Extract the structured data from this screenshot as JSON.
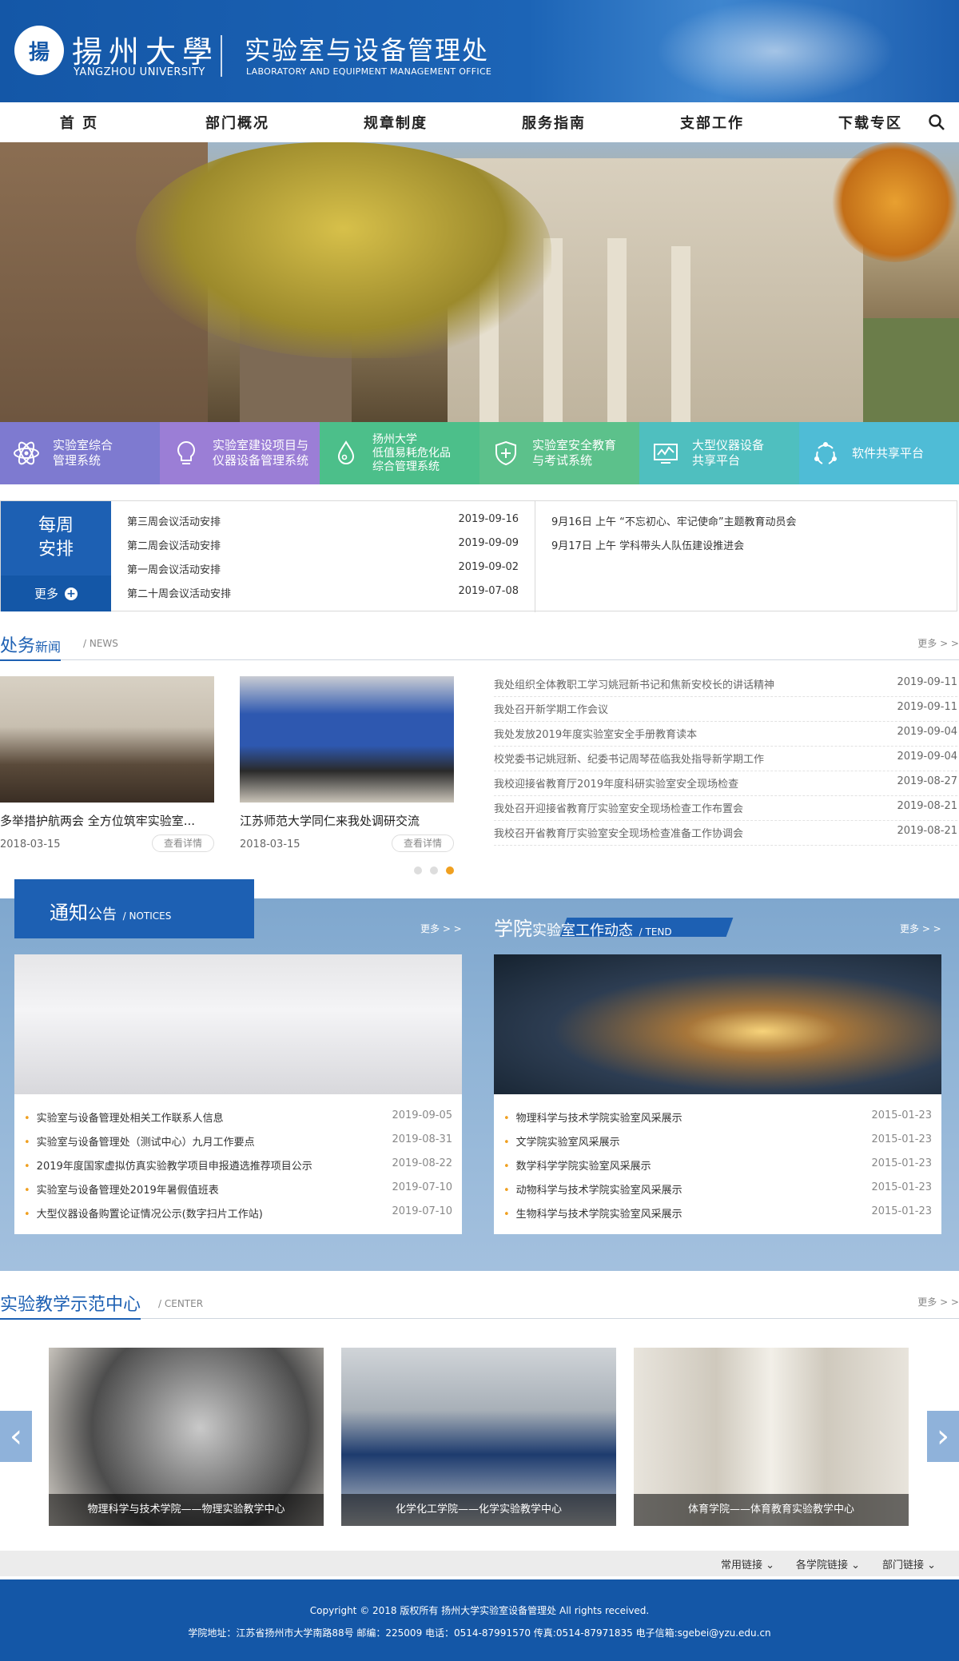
{
  "header": {
    "logo_glyph": "揚",
    "university_cn": "揚州大學",
    "university_en": "YANGZHOU UNIVERSITY",
    "office_cn": "实验室与设备管理处",
    "office_en": "LABORATORY AND EQUIPMENT MANAGEMENT OFFICE"
  },
  "nav": {
    "items": [
      "首 页",
      "部门概况",
      "规章制度",
      "服务指南",
      "支部工作",
      "下载专区"
    ],
    "search_icon": "search-icon"
  },
  "quick_links": [
    {
      "label": "实验室综合\n管理系统",
      "icon": "atom-icon",
      "color": "#7e7ad0"
    },
    {
      "label": "实验室建设项目与\n仪器设备管理系统",
      "icon": "lightbulb-icon",
      "color": "#9b7ed6"
    },
    {
      "label": "扬州大学\n低值易耗危化品\n综合管理系统",
      "icon": "flask-drop-icon",
      "color": "#4cbf8a"
    },
    {
      "label": "实验室安全教育\n与考试系统",
      "icon": "shield-plus-icon",
      "color": "#5cc18b"
    },
    {
      "label": "大型仪器设备\n共享平台",
      "icon": "monitor-chart-icon",
      "color": "#4fbfbf"
    },
    {
      "label": "软件共享平台",
      "icon": "share-circle-icon",
      "color": "#4fbcd6"
    }
  ],
  "weekly": {
    "title_line1": "每周",
    "title_line2": "安排",
    "more": "更多",
    "rows": [
      {
        "title": "第三周会议活动安排",
        "date": "2019-09-16"
      },
      {
        "title": "第二周会议活动安排",
        "date": "2019-09-09"
      },
      {
        "title": "第一周会议活动安排",
        "date": "2019-09-02"
      },
      {
        "title": "第二十周会议活动安排",
        "date": "2019-07-08"
      }
    ],
    "notes": [
      "9月16日 上午 “不忘初心、牢记使命”主题教育动员会",
      "9月17日 上午 学科带头人队伍建设推进会"
    ]
  },
  "news": {
    "title_main": "处务",
    "title_sub": "新闻",
    "title_en": "/ NEWS",
    "more": "更多 > >",
    "cards": [
      {
        "caption": "多举措护航两会 全方位筑牢实验室...",
        "date": "2018-03-15",
        "button": "查看详情"
      },
      {
        "caption": "江苏师范大学同仁来我处调研交流",
        "date": "2018-03-15",
        "button": "查看详情"
      }
    ],
    "list": [
      {
        "title": "我处组织全体教职工学习姚冠新书记和焦新安校长的讲话精神",
        "date": "2019-09-11"
      },
      {
        "title": "我处召开新学期工作会议",
        "date": "2019-09-11"
      },
      {
        "title": "我处发放2019年度实验室安全手册教育读本",
        "date": "2019-09-04"
      },
      {
        "title": "校党委书记姚冠新、纪委书记周琴莅临我处指导新学期工作",
        "date": "2019-09-04"
      },
      {
        "title": "我校迎接省教育厅2019年度科研实验室安全现场检查",
        "date": "2019-08-27"
      },
      {
        "title": "我处召开迎接省教育厅实验室安全现场检查工作布置会",
        "date": "2019-08-21"
      },
      {
        "title": "我校召开省教育厅实验室安全现场检查准备工作协调会",
        "date": "2019-08-21"
      }
    ]
  },
  "notices": {
    "title_main": "通知",
    "title_sub": "公告",
    "title_en": "/ NOTICES",
    "more": "更多 > >",
    "rows": [
      {
        "title": "实验室与设备管理处相关工作联系人信息",
        "date": "2019-09-05"
      },
      {
        "title": "实验室与设备管理处（测试中心）九月工作要点",
        "date": "2019-08-31"
      },
      {
        "title": "2019年度国家虚拟仿真实验教学项目申报遴选推荐项目公示",
        "date": "2019-08-22"
      },
      {
        "title": "实验室与设备管理处2019年暑假值班表",
        "date": "2019-07-10"
      },
      {
        "title": "大型仪器设备购置论证情况公示(数字扫片工作站)",
        "date": "2019-07-10"
      }
    ]
  },
  "dynamics": {
    "title_main": "学院",
    "title_sub": "实验室工作动态",
    "title_en": "/ TEND",
    "more": "更多 > >",
    "rows": [
      {
        "title": "物理科学与技术学院实验室风采展示",
        "date": "2015-01-23"
      },
      {
        "title": "文学院实验室风采展示",
        "date": "2015-01-23"
      },
      {
        "title": "数学科学学院实验室风采展示",
        "date": "2015-01-23"
      },
      {
        "title": "动物科学与技术学院实验室风采展示",
        "date": "2015-01-23"
      },
      {
        "title": "生物科学与技术学院实验室风采展示",
        "date": "2015-01-23"
      }
    ]
  },
  "center": {
    "title_main": "实验教学示范中心",
    "title_en": "/ CENTER",
    "more": "更多 > >",
    "cards": [
      "物理科学与技术学院——物理实验教学中心",
      "化学化工学院——化学实验教学中心",
      "体育学院——体育教育实验教学中心"
    ]
  },
  "links": [
    "常用链接",
    "各学院链接",
    "部门链接"
  ],
  "footer": {
    "copyright": "Copyright © 2018 版权所有 扬州大学实验室设备管理处 All rights received.",
    "contact": "学院地址：江苏省扬州市大学南路88号   邮编：225009   电话：0514-87991570   传真:0514-87971835   电子信箱:sgebei@yzu.edu.cn"
  }
}
